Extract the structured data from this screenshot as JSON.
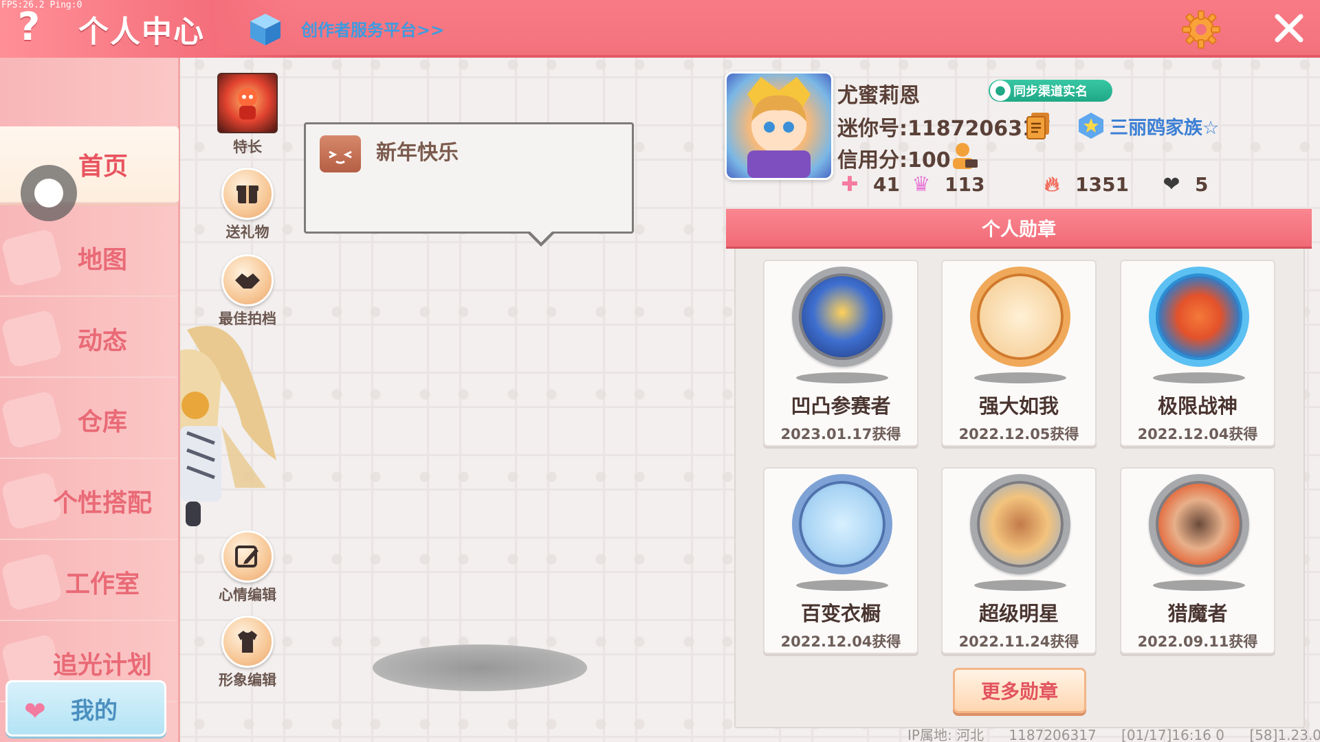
{
  "overlay": {
    "fps": "FPS:26.2  Ping:0"
  },
  "header": {
    "title": "个人中心",
    "creator_link": "创作者服务平台>>",
    "help_glyph": "?"
  },
  "sidebar": {
    "items": [
      {
        "label": "首页",
        "active": true
      },
      {
        "label": "地图"
      },
      {
        "label": "动态"
      },
      {
        "label": "仓库"
      },
      {
        "label": "个性搭配"
      },
      {
        "label": "工作室"
      },
      {
        "label": "追光计划"
      }
    ],
    "my_button": "我的"
  },
  "actions": {
    "specialty": "特长",
    "send_gift": "送礼物",
    "best_partner": "最佳拍档",
    "mood_edit": "心情编辑",
    "image_edit": "形象编辑"
  },
  "bubble": {
    "text": "新年快乐"
  },
  "profile": {
    "nickname": "尤蜜莉恩",
    "sync_label": "同步渠道实名",
    "mini_id": "迷你号:1187206317",
    "family": "三丽鸥家族☆",
    "credit": "信用分:100",
    "stats": {
      "gift": "41",
      "fans": "113",
      "heat": "1351",
      "likes": "5"
    }
  },
  "medals": {
    "header": "个人勋章",
    "items": [
      {
        "name": "凹凸参赛者",
        "date": "2023.01.17获得",
        "color": "#2c5aa8"
      },
      {
        "name": "强大如我",
        "date": "2022.12.05获得",
        "color": "#f5b46a"
      },
      {
        "name": "极限战神",
        "date": "2022.12.04获得",
        "color": "#3aa0e8"
      },
      {
        "name": "百变衣橱",
        "date": "2022.12.04获得",
        "color": "#79b7e4"
      },
      {
        "name": "超级明星",
        "date": "2022.11.24获得",
        "color": "#f3c7a0"
      },
      {
        "name": "猎魔者",
        "date": "2022.09.11获得",
        "color": "#e9a184"
      }
    ],
    "more_button": "更多勋章"
  },
  "footer": {
    "ip": "IP属地: 河北",
    "uid": "1187206317",
    "build": "[01/17]16:16 0",
    "version": "[58]1.23.0"
  },
  "colors": {
    "accent": "#f2717c",
    "sidebar": "#f8b6b8",
    "link": "#3d9be0"
  }
}
